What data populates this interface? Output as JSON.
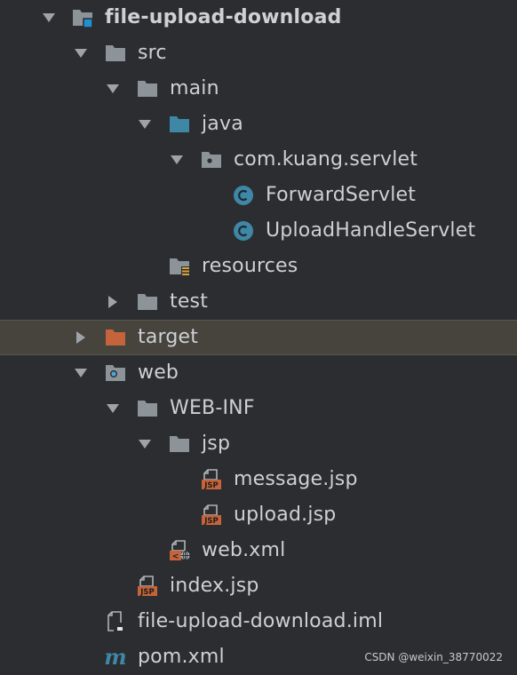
{
  "project_tree": {
    "root": {
      "label": "file-upload-download",
      "expanded": true
    },
    "src": {
      "label": "src",
      "expanded": true
    },
    "main": {
      "label": "main",
      "expanded": true
    },
    "java": {
      "label": "java",
      "expanded": true
    },
    "package": {
      "label": "com.kuang.servlet",
      "expanded": true
    },
    "class_forward": {
      "label": "ForwardServlet",
      "icon": "class-icon"
    },
    "class_upload": {
      "label": "UploadHandleServlet",
      "icon": "class-icon"
    },
    "resources": {
      "label": "resources"
    },
    "test": {
      "label": "test",
      "expanded": false
    },
    "target": {
      "label": "target",
      "expanded": false,
      "selected": true
    },
    "web": {
      "label": "web",
      "expanded": true
    },
    "webinf": {
      "label": "WEB-INF",
      "expanded": true
    },
    "jsp_dir": {
      "label": "jsp",
      "expanded": true
    },
    "message_jsp": {
      "label": "message.jsp"
    },
    "upload_jsp": {
      "label": "upload.jsp"
    },
    "web_xml": {
      "label": "web.xml"
    },
    "index_jsp": {
      "label": "index.jsp"
    },
    "iml": {
      "label": "file-upload-download.iml"
    },
    "pom": {
      "label": "pom.xml"
    }
  },
  "colors": {
    "background": "#2b2d30",
    "folder": "#8c9399",
    "source_folder": "#3f87a6",
    "excluded_folder": "#c5643a",
    "jsp_badge": "#c5643a",
    "class_circle": "#3f87a6",
    "selection": "#47443e"
  },
  "watermark": "CSDN @weixin_38770022"
}
